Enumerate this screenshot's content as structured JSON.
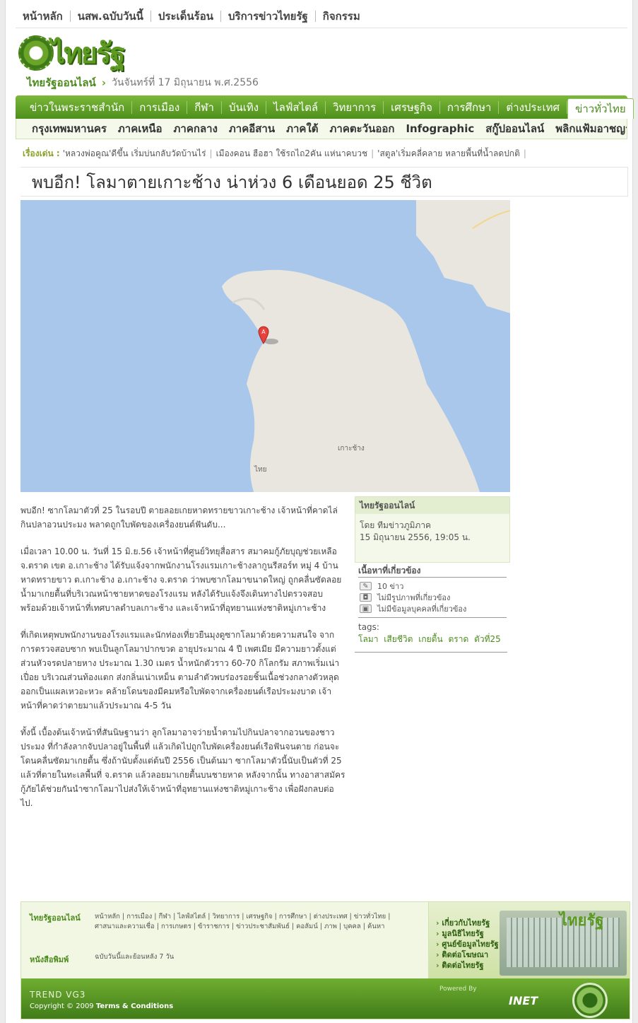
{
  "toplinks": [
    "หน้าหลัก",
    "นสพ.ฉบับวันนี้",
    "ประเด็นร้อน",
    "บริการข่าวไทยรัฐ",
    "กิจกรรม"
  ],
  "logo_text": "ไทยรัฐ",
  "breadcrumb": {
    "site": "ไทยรัฐออนไลน์",
    "date": "วันจันทร์ที่ 17 มิถุนายน พ.ศ.2556"
  },
  "mainnav": [
    "ข่าวในพระราชสำนัก",
    "การเมือง",
    "กีฬา",
    "บันเทิง",
    "ไลฟ์สไตล์",
    "วิทยาการ",
    "เศรษฐกิจ",
    "การศึกษา",
    "ต่างประเทศ",
    "ข่าวทั่วไทย"
  ],
  "subnav": [
    "กรุงเทพมหานคร",
    "ภาคเหนือ",
    "ภาคกลาง",
    "ภาคอีสาน",
    "ภาคใต้",
    "ภาคตะวันออก",
    "Infographic",
    "สกู๊ปออนไลน์",
    "พลิกแฟ้มอาชญากรรม"
  ],
  "headlines": {
    "label": "เรื่องเด่น :",
    "items": [
      "'หลวงพ่อคูณ'ดีขึ้น เริ่มบ่นกลับวัดบ้านไร่",
      "เมืองคอน ฮือฮา ใช้รถไถ2คัน แห่นาคบวช",
      "'สตูล'เริ่มคลี่คลาย หลายพื้นที่น้ำลดปกติ"
    ]
  },
  "title": "พบอีก! โลมาตายเกาะช้าง น่าห่วง 6 เดือนยอด 25 ชีวิต",
  "map": {
    "label_island": "เกาะช้าง",
    "label_country": "ไทย",
    "marker": "A"
  },
  "article": [
    "พบอีก! ซากโลมาตัวที่ 25 ในรอบปี ตายลอยเกยหาดทรายขาวเกาะช้าง เจ้าหน้าที่คาดไล่กินปลาอวนประมง พลาดถูกใบพัดของเครื่องยนต์ฟันดับ...",
    "เมื่อเวลา 10.00 น. วันที่ 15 มิ.ย.56 เจ้าหน้าที่ศูนย์วิทยุสื่อสาร สมาคมกู้ภัยบุญช่วยเหลือ จ.ตราด เขต อ.เกาะช้าง ได้รับแจ้งจากพนักงานโรงแรมเกาะช้างลากูนรีสอร์ท หมู่ 4 บ้านหาดทรายขาว ต.เกาะช้าง อ.เกาะช้าง จ.ตราด ว่าพบซากโลมาขนาดใหญ่ ถูกคลื่นซัดลอยน้ำมาเกยตื้นที่บริเวณหน้าชายหาดของโรงแรม หลังได้รับแจ้งจึงเดินทางไปตรวจสอบ พร้อมด้วยเจ้าหน้าที่เทศบาลตำบลเกาะช้าง และเจ้าหน้าที่อุทยานแห่งชาติหมู่เกาะช้าง",
    "ที่เกิดเหตุพบพนักงานของโรงแรมและนักท่องเที่ยวยืนมุงดูซากโลมาด้วยความสนใจ จากการตรวจสอบซาก พบเป็นลูกโลมาปากขวด อายุประมาณ 4 ปี เพศเมีย มีความยาวตั้งแต่ส่วนหัวจรดปลายหาง ประมาณ 1.30 เมตร น้ำหนักตัวราว 60-70 กิโลกรัม สภาพเริ่มเน่าเปื่อย บริเวณส่วนท้องแตก ส่งกลิ่นเน่าเหม็น ตามลำตัวพบร่องรอยชิ้นเนื้อช่วงกลางตัวหลุดออกเป็นแผลเหวอะหวะ คล้ายโดนของมีคมหรือใบพัดจากเครื่องยนต์เรือประมงบาด เจ้าหน้าที่คาดว่าตายมาแล้วประมาณ 4-5 วัน",
    "ทั้งนี้ เบื้องต้นเจ้าหน้าที่สันนิษฐานว่า ลูกโลมาอาจว่ายน้ำตามไปกินปลาจากอวนของชาวประมง ที่กำลังลากจับปลาอยู่ในพื้นที่ แล้วเกิดไปถูกใบพัดเครื่องยนต์เรือฟันจนตาย ก่อนจะโดนคลื่นซัดมาเกยตื้น ซึ่งถ้านับตั้งแต่ต้นปี 2556 เป็นต้นมา ซากโลมาตัวนี้นับเป็นตัวที่ 25 แล้วที่ตายในทะเลพื้นที่ จ.ตราด แล้วลอยมาเกยตื้นบนชายหาด หลังจากนั้น ทางอาสาสมัครกู้ภัยได้ช่วยกันนำซากโลมาไปส่งให้เจ้าหน้าที่อุทยานแห่งชาติหมู่เกาะช้าง เพื่อฝังกลบต่อไป."
  ],
  "infobox": {
    "head": "ไทยรัฐออนไลน์",
    "by": "โดย  ทีมข่าวภูมิภาค",
    "date": "15 มิถุนายน 2556, 19:05 น."
  },
  "related": {
    "head": "เนื้อหาที่เกี่ยวข้อง",
    "news": "10 ข่าว",
    "photos": "ไม่มีรูปภาพที่เกี่ยวข้อง",
    "persons": "ไม่มีข้อมูลบุคคลที่เกี่ยวข้อง",
    "tags_label": "tags:",
    "tags": [
      "โลมา",
      "เสียชีวิต",
      "เกยตื้น",
      "ตราด",
      "ตัวที่25"
    ]
  },
  "footer": {
    "col1": "ไทยรัฐออนไลน์",
    "col2": "หนังสือพิมพ์",
    "links1": [
      "หน้าหลัก",
      "การเมือง",
      "กีฬา",
      "ไลฟ์สไตล์",
      "วิทยาการ",
      "เศรษฐกิจ",
      "การศึกษา",
      "ต่างประเทศ",
      "ข่าวทั่วไทย",
      "ศาสนาและความเชื่อ",
      "การเกษตร",
      "ข้าราชการ",
      "ข่าวประชาสัมพันธ์",
      "คอลัมน์",
      "ภาพ",
      "บุคคล",
      "ค้นหา"
    ],
    "links2": "ฉบับวันนี้และย้อนหลัง 7 วัน",
    "right_menu": [
      "เกี่ยวกับไทยรัฐ",
      "มูลนิธิไทยรัฐ",
      "ศูนย์ข้อมูลไทยรัฐ",
      "ติดต่อโฆษณา",
      "ติดต่อไทยรัฐ"
    ],
    "right_logo": "ไทยรัฐ",
    "trend": "TREND VG3",
    "copyright": "Copyright © 2009",
    "terms": "Terms & Conditions",
    "powered": "Powered By",
    "inet": "INET"
  }
}
